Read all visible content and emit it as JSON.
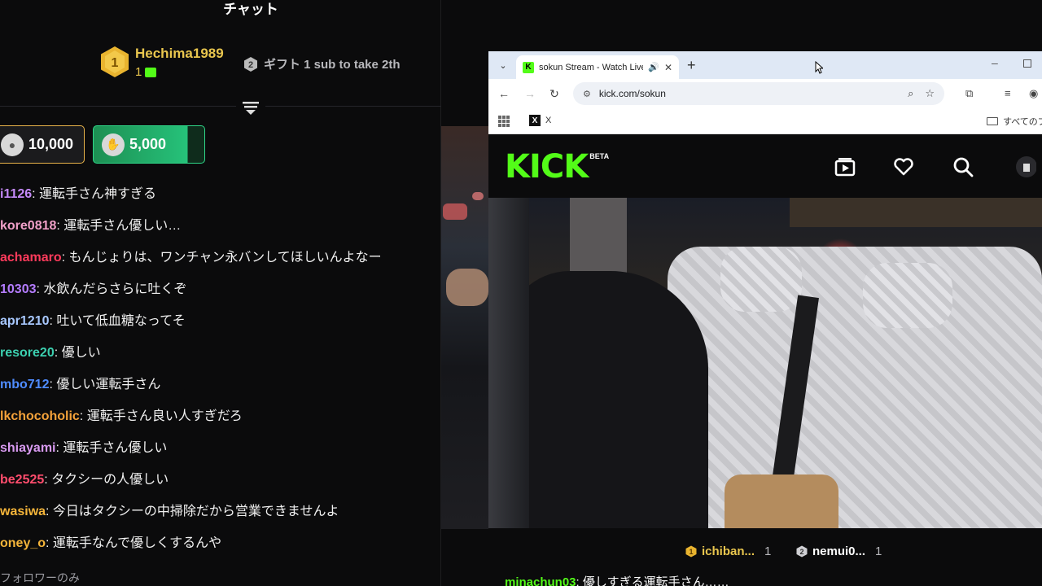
{
  "chat": {
    "title": "チャット",
    "pinned": {
      "rank": "1",
      "username": "Hechima1989",
      "count": "1"
    },
    "gift_banner": {
      "rank": "2",
      "text": "ギフト 1 sub to take 2th"
    },
    "goals": [
      {
        "value": "10,000"
      },
      {
        "value": "5,000",
        "progress": 0.85
      }
    ],
    "messages": [
      {
        "user": "i1126",
        "color": "#c58af9",
        "text": "運転手さん神すぎる"
      },
      {
        "user": "kore0818",
        "color": "#f0a0c8",
        "text": "運転手さん優しい…"
      },
      {
        "user": "achamaro",
        "color": "#ff3b5c",
        "text": "もんじょりは、ワンチャン永バンしてほしいんよなー"
      },
      {
        "user": "10303",
        "color": "#b47cff",
        "text": "水飲んだらさらに吐くぞ"
      },
      {
        "user": "apr1210",
        "color": "#a8c8ff",
        "text": "吐いて低血糖なってそ"
      },
      {
        "user": "resore20",
        "color": "#3cd0b0",
        "text": "優しい"
      },
      {
        "user": "mbo712",
        "color": "#4f8cff",
        "text": "優しい運転手さん"
      },
      {
        "user": "lkchocoholic",
        "color": "#f5a23a",
        "text": "運転手さん良い人すぎだろ"
      },
      {
        "user": "shiayami",
        "color": "#d89af0",
        "text": "運転手さん優しい"
      },
      {
        "user": "be2525",
        "color": "#ff4d6d",
        "text": "タクシーの人優しい"
      },
      {
        "user": "wasiwa",
        "color": "#f5b53a",
        "text": "今日はタクシーの中掃除だから営業できませんよ"
      },
      {
        "user": "oney_o",
        "color": "#f5b53a",
        "text": "運転手なんで優しくするんや"
      }
    ],
    "footer": "フォロワーのみ"
  },
  "browser": {
    "tab_title": "sokun Stream - Watch Live",
    "url": "kick.com/sokun",
    "bookmark_x": "X",
    "bookmarks_all": "すべてのブ"
  },
  "kick": {
    "logo": "KICK",
    "beta": "BETA",
    "gifters": [
      {
        "rank": "1",
        "name": "ichiban...",
        "count": "1"
      },
      {
        "rank": "2",
        "name": "nemui0...",
        "count": "1"
      }
    ],
    "message": {
      "user": "minachun03",
      "text": "優しすぎる運転手さん……"
    }
  }
}
